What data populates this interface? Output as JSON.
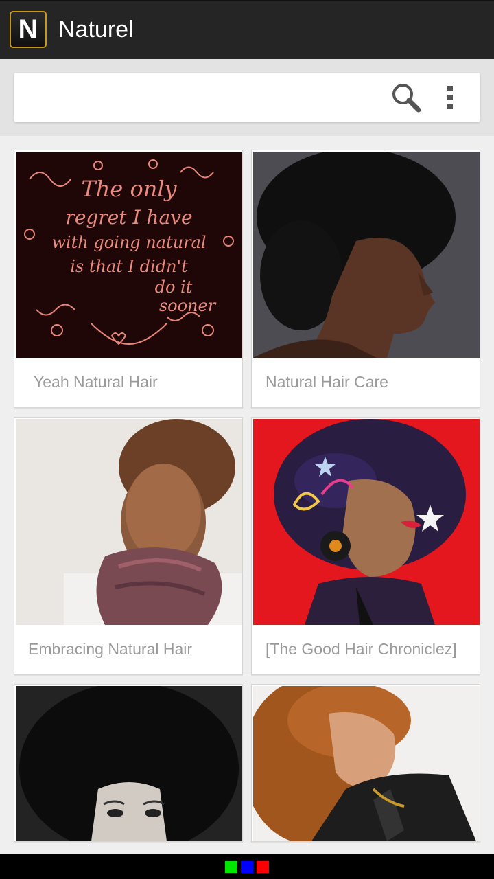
{
  "app": {
    "logo_letter": "N",
    "title": "Naturel"
  },
  "toolbar": {
    "search_icon": "search-icon",
    "menu_icon": "overflow-menu-icon"
  },
  "cards": [
    {
      "label": "Yeah Natural Hair"
    },
    {
      "label": "Natural Hair Care"
    },
    {
      "label": "Embracing Natural Hair"
    },
    {
      "label": "[The Good Hair Chroniclez]"
    },
    {
      "label": ""
    },
    {
      "label": ""
    }
  ],
  "quote_art": {
    "lines": [
      "The only",
      "regret I have",
      "with going natural",
      "is that I didn't",
      "do it",
      "sooner"
    ]
  },
  "colors": {
    "appbar": "#252525",
    "logo_border": "#c79a16",
    "card_label": "#9a9a9a",
    "indicator_green": "#00e600",
    "indicator_blue": "#0000ff",
    "indicator_red": "#ff0000"
  }
}
